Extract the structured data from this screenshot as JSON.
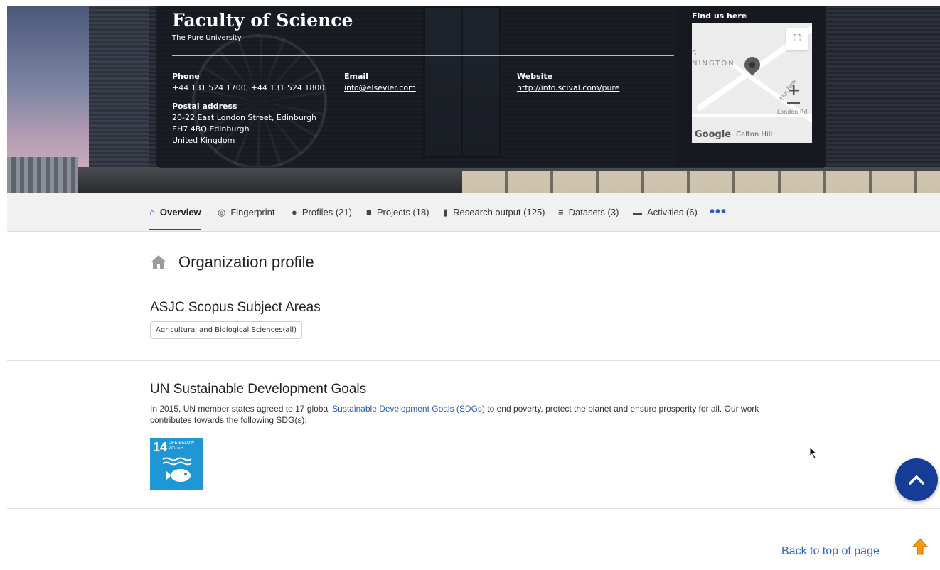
{
  "hero": {
    "org_name": "Faculty of Science",
    "parent_link": "The Pure University",
    "phone_label": "Phone",
    "phone_value": "+44 131 524 1700, +44 131 524 1800",
    "email_label": "Email",
    "email_value": "info@elsevier.com",
    "website_label": "Website",
    "website_value": "http://info.scival.com/pure",
    "postal_label": "Postal address",
    "postal_lines": [
      "20-22 East London Street, Edinburgh",
      "EH7 4BQ Edinburgh",
      "United Kingdom"
    ],
    "map_title": "Find us here",
    "map": {
      "area_label": "NINGTON",
      "area_label_prefix": "S",
      "road_labels": [
        "Elm Row",
        "London Rd",
        "Calton Hill"
      ],
      "logo": "Google"
    }
  },
  "nav": {
    "tabs": [
      {
        "label": "Overview",
        "icon": "home-icon"
      },
      {
        "label": "Fingerprint",
        "icon": "fingerprint-icon"
      },
      {
        "label": "Profiles (21)",
        "icon": "person-icon"
      },
      {
        "label": "Projects (18)",
        "icon": "cube-icon"
      },
      {
        "label": "Research output (125)",
        "icon": "book-icon"
      },
      {
        "label": "Datasets (3)",
        "icon": "list-icon"
      },
      {
        "label": "Activities (6)",
        "icon": "briefcase-icon"
      }
    ],
    "more": "•••",
    "active_color": "#1c4a8e"
  },
  "main": {
    "profile_title": "Organization profile",
    "asjc_title": "ASJC Scopus Subject Areas",
    "asjc_tags": [
      "Agricultural and Biological Sciences(all)"
    ],
    "sdg_title": "UN Sustainable Development Goals",
    "sdg_text_before": "In 2015, UN member states agreed to 17 global ",
    "sdg_link": "Sustainable Development Goals (SDGs)",
    "sdg_text_after": " to end poverty, protect the planet and ensure prosperity for all. Our work contributes towards the following SDG(s):",
    "sdg_tile": {
      "number": "14",
      "label_line1": "LIFE BELOW",
      "label_line2": "WATER",
      "color": "#1e97d4"
    }
  },
  "footer": {
    "back_to_top": "Back to top of page",
    "scroll_button_color": "#163d96",
    "link_color": "#2966cc"
  }
}
